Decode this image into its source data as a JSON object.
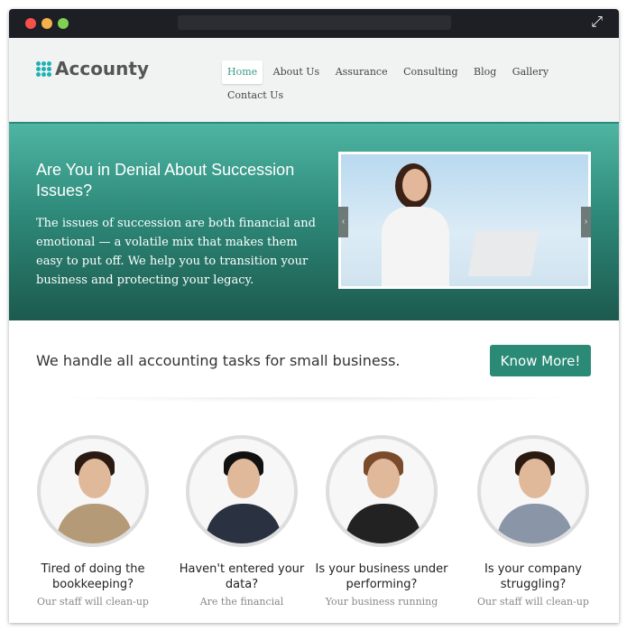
{
  "brand": {
    "name": "Accounty",
    "accent": "#2a8a76"
  },
  "nav": {
    "items": [
      "Home",
      "About Us",
      "Assurance",
      "Consulting",
      "Blog",
      "Gallery",
      "Contact Us"
    ],
    "active": "Home"
  },
  "hero": {
    "title": "Are You in Denial About Succession Issues?",
    "text": "The issues of succession are both financial and emotional — a volatile mix that makes them easy to put off. We help you to transition your business and protecting your legacy.",
    "prev": "‹",
    "next": "›"
  },
  "cta": {
    "tagline": "We handle all accounting tasks for small business.",
    "button": "Know More!"
  },
  "cards": [
    {
      "title": "Tired of doing the bookkeeping?",
      "text": "Our staff will clean-up"
    },
    {
      "title": "Haven't entered your data?",
      "text": "Are the financial"
    },
    {
      "title": "Is your business under performing?",
      "text": "Your business running"
    },
    {
      "title": "Is your company struggling?",
      "text": "Our staff will clean-up"
    }
  ]
}
